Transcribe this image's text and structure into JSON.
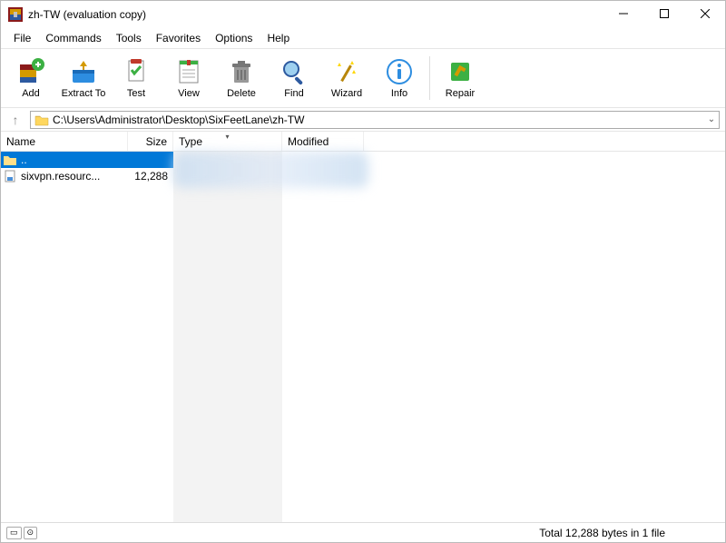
{
  "title": "zh-TW (evaluation copy)",
  "menu": {
    "file": "File",
    "commands": "Commands",
    "tools": "Tools",
    "favorites": "Favorites",
    "options": "Options",
    "help": "Help"
  },
  "toolbar": {
    "add": "Add",
    "extract": "Extract To",
    "test": "Test",
    "view": "View",
    "delete": "Delete",
    "find": "Find",
    "wizard": "Wizard",
    "info": "Info",
    "repair": "Repair"
  },
  "path": "C:\\Users\\Administrator\\Desktop\\SixFeetLane\\zh-TW",
  "columns": {
    "name": "Name",
    "size": "Size",
    "type": "Type",
    "modified": "Modified"
  },
  "rows": {
    "parent": {
      "name": ".."
    },
    "file1": {
      "name": "sixvpn.resourc...",
      "size": "12,288"
    }
  },
  "status": "Total 12,288 bytes in 1 file"
}
